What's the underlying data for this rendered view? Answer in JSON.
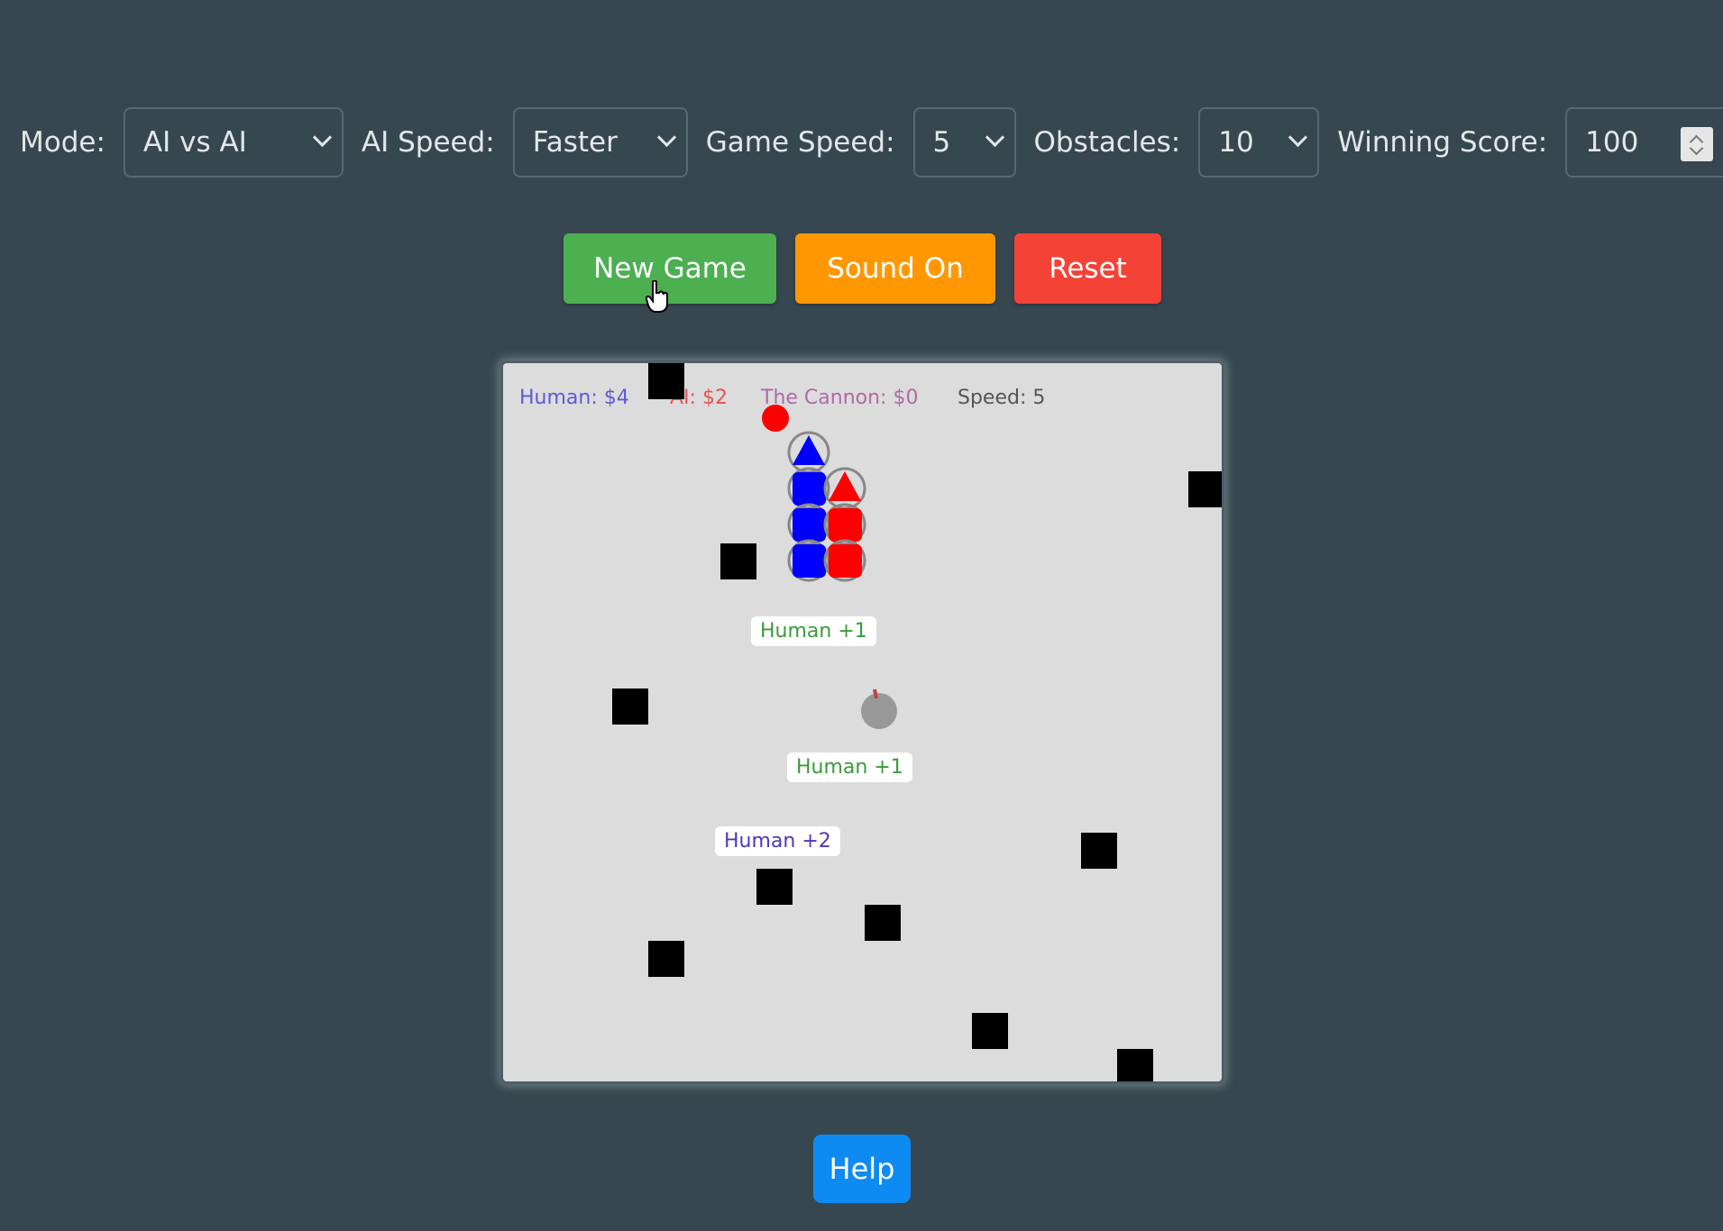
{
  "controls": {
    "mode": {
      "label": "Mode:",
      "value": "AI vs AI"
    },
    "ai_speed": {
      "label": "AI Speed:",
      "value": "Faster"
    },
    "game_speed": {
      "label": "Game Speed:",
      "value": "5"
    },
    "obstacles": {
      "label": "Obstacles:",
      "value": "10"
    },
    "winning_score": {
      "label": "Winning Score:",
      "value": "100"
    }
  },
  "buttons": {
    "new_game": "New Game",
    "sound": "Sound On",
    "reset": "Reset",
    "help": "Help"
  },
  "colors": {
    "new_game": "#4caf50",
    "sound": "#ff9800",
    "reset": "#f44336",
    "help": "#0d8bf2",
    "human": "#0000ff",
    "ai": "#ff0000"
  },
  "hud": {
    "human": "Human: $4",
    "ai": "AI: $2",
    "cannon": "The Cannon: $0",
    "speed": "Speed: 5"
  },
  "popups": [
    "Human +1",
    "Human +1",
    "Human +2"
  ]
}
